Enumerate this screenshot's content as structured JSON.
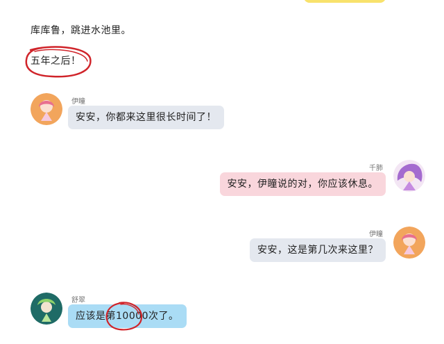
{
  "narration": {
    "line1": "库库鲁，跳进水池里。",
    "line2": "五年之后！"
  },
  "messages": [
    {
      "speaker": "伊瞳",
      "text": "安安，你都来这里很长时间了！",
      "side": "left",
      "color": "#e4e8ef"
    },
    {
      "speaker": "千肺",
      "text": "安安，伊瞳说的对，你应该休息。",
      "side": "right",
      "color": "#f9d6dc"
    },
    {
      "speaker": "伊瞳",
      "text": "安安，这是第几次来这里？",
      "side": "right",
      "color": "#e4e8ef"
    },
    {
      "speaker": "舒翠",
      "text": "应该是第10000次了。",
      "side": "left",
      "color": "#aadcf5"
    }
  ],
  "annotation_color": "#d0242a"
}
